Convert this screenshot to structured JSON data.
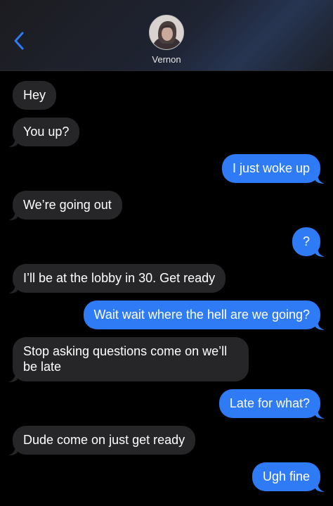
{
  "header": {
    "contact_name": "Vernon",
    "back_icon": "chevron-left-icon",
    "accent_color": "#2f7bf5"
  },
  "messages": [
    {
      "from": "contact",
      "text": "Hey"
    },
    {
      "from": "contact",
      "text": "You up?"
    },
    {
      "from": "me",
      "text": "I just woke up"
    },
    {
      "from": "contact",
      "text": "We’re going out"
    },
    {
      "from": "me",
      "text": "?"
    },
    {
      "from": "contact",
      "text": "I’ll be at the lobby in 30. Get ready"
    },
    {
      "from": "me",
      "text": "Wait wait where the hell are we going?"
    },
    {
      "from": "contact",
      "text": "Stop asking questions come on we’ll be late"
    },
    {
      "from": "me",
      "text": "Late for what?"
    },
    {
      "from": "contact",
      "text": "Dude come on just get ready"
    },
    {
      "from": "me",
      "text": "Ugh fine"
    }
  ]
}
